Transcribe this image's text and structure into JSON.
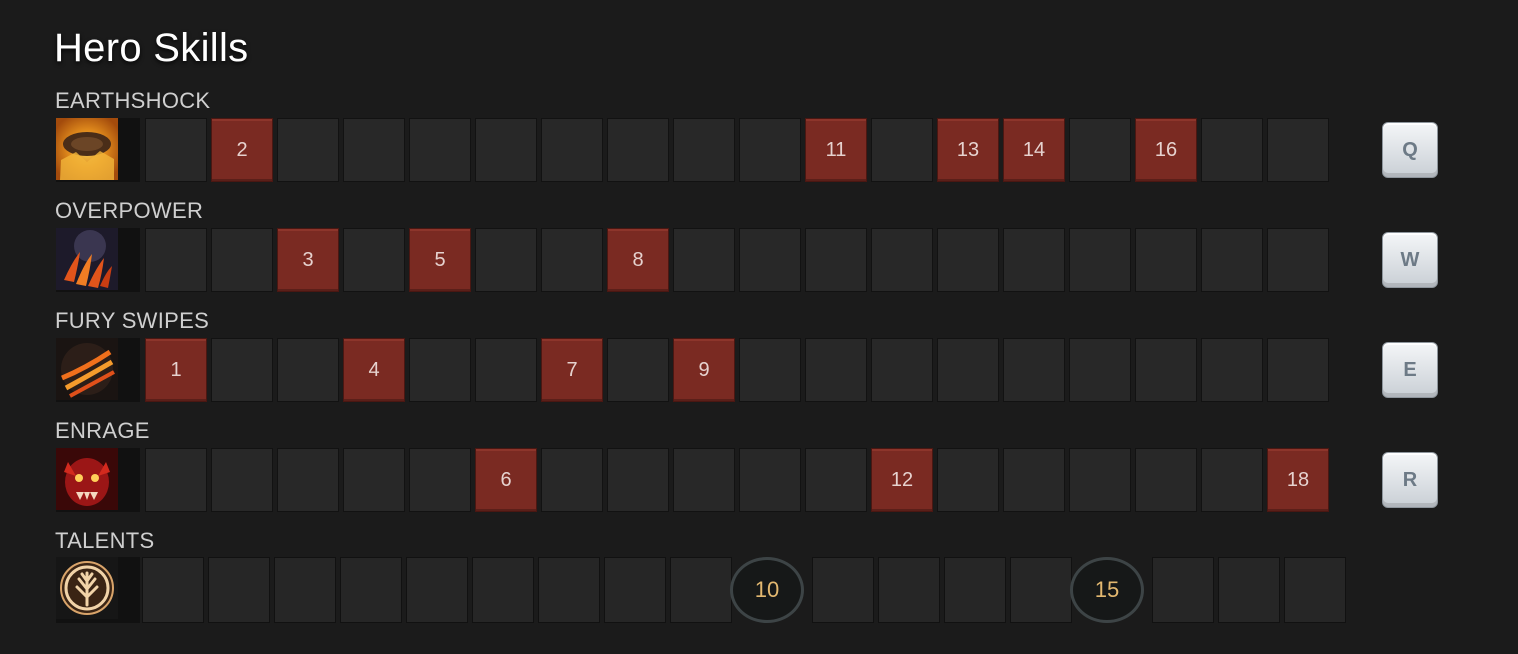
{
  "title": "Hero Skills",
  "skills": [
    {
      "name": "EARTHSHOCK",
      "icon": "earthshock-icon",
      "hotkey": "Q",
      "levels": [
        2,
        11,
        13,
        14,
        16
      ]
    },
    {
      "name": "OVERPOWER",
      "icon": "overpower-icon",
      "hotkey": "W",
      "levels": [
        3,
        5,
        8
      ]
    },
    {
      "name": "FURY SWIPES",
      "icon": "fury-swipes-icon",
      "hotkey": "E",
      "levels": [
        1,
        4,
        7,
        9
      ]
    },
    {
      "name": "ENRAGE",
      "icon": "enrage-icon",
      "hotkey": "R",
      "levels": [
        6,
        12,
        18
      ]
    }
  ],
  "talents": {
    "name": "TALENTS",
    "icon": "talent-tree-icon",
    "levels": [
      10,
      15
    ]
  },
  "colors": {
    "background": "#1b1b1b",
    "cell": "#282828",
    "picked": "#7a2a22",
    "talent_level_text": "#e3b870"
  }
}
